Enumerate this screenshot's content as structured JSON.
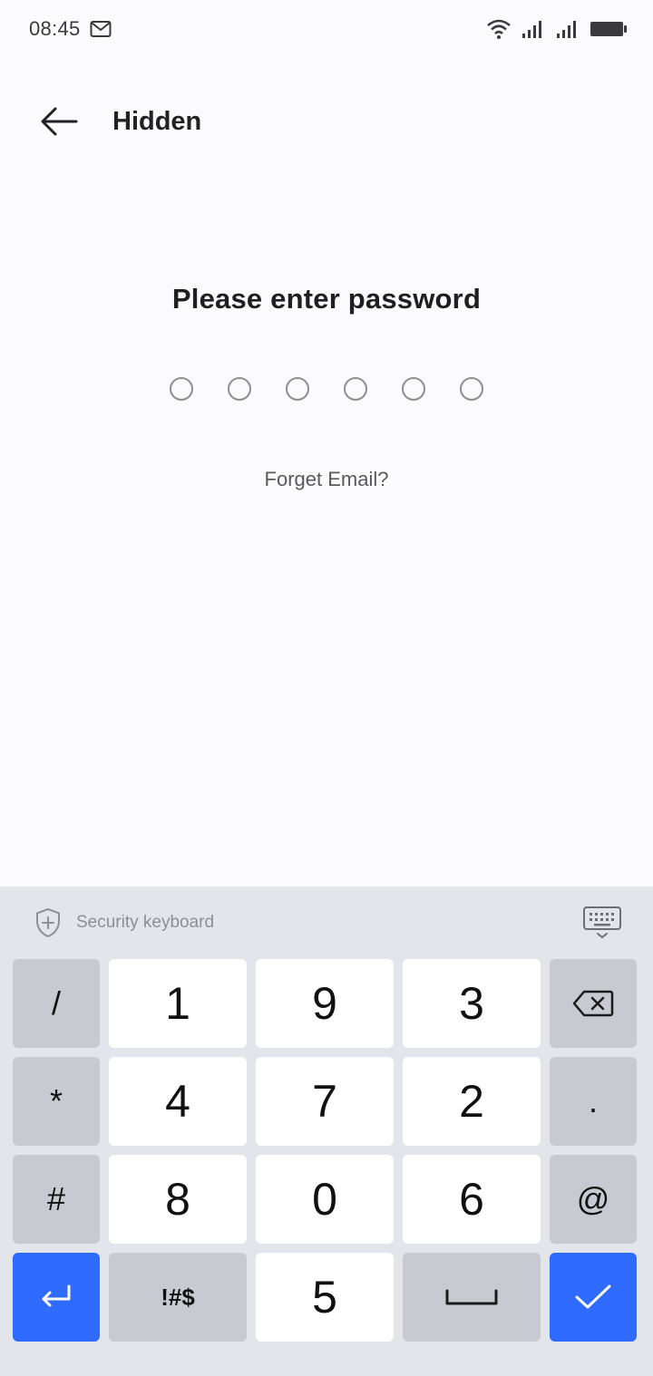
{
  "status_bar": {
    "time": "08:45",
    "icons": [
      "email-icon",
      "wifi-icon",
      "signal-icon",
      "signal-icon",
      "battery-icon"
    ]
  },
  "header": {
    "title": "Hidden",
    "back_icon": "back-arrow-icon"
  },
  "content": {
    "prompt": "Please enter password",
    "pin_length": 6,
    "forgot_link": "Forget Email?"
  },
  "keyboard": {
    "label": "Security keyboard",
    "label_icon": "shield-plus-icon",
    "hide_icon": "keyboard-hide-icon",
    "keys": {
      "slash": "/",
      "k1": "1",
      "k9": "9",
      "k3": "3",
      "star": "*",
      "k4": "4",
      "k7": "7",
      "k2": "2",
      "dot": ".",
      "hash": "#",
      "k8": "8",
      "k0": "0",
      "k6": "6",
      "at": "@",
      "symbols": "!#$",
      "k5": "5"
    },
    "colors": {
      "accent": "#2f6bff",
      "function_key": "#c8cad1",
      "background": "#e4e5ea"
    }
  }
}
